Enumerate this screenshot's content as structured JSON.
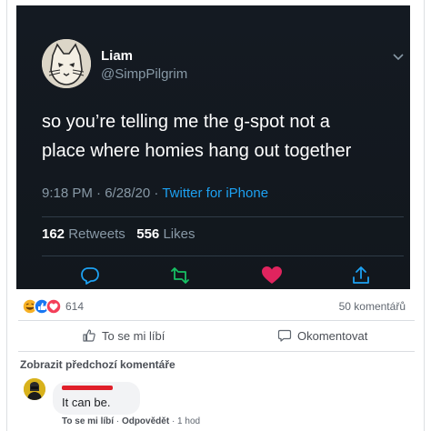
{
  "tweet": {
    "name": "Liam",
    "handle": "@SimpPilgrim",
    "text_line1": "so you’re telling me the g-spot not a",
    "text_line2": "place where homies hang out together",
    "time": "9:18 PM · 6/28/20 · ",
    "source": "Twitter for iPhone",
    "retweets_count": "162",
    "retweets_label": "Retweets",
    "likes_count": "556",
    "likes_label": "Likes",
    "colors": {
      "background": "#141a22",
      "accent": "#1da1f2",
      "retweet": "#17bf63",
      "like": "#e0245e",
      "muted": "#8899a6"
    },
    "icons": [
      "reply-icon",
      "retweet-icon",
      "heart-icon",
      "share-icon",
      "chevron-down-icon"
    ]
  },
  "post": {
    "reactions_count": "614",
    "comments_count": "50 komentářů",
    "like_label": "To se mi líbí",
    "comment_label": "Okomentovat",
    "previous_comments": "Zobrazit předchozí komentáře"
  },
  "comment": {
    "text": "It can be.",
    "like": "To se mi líbí",
    "dot": " · ",
    "reply": "Odpovědět",
    "time": " · 1 hod"
  }
}
